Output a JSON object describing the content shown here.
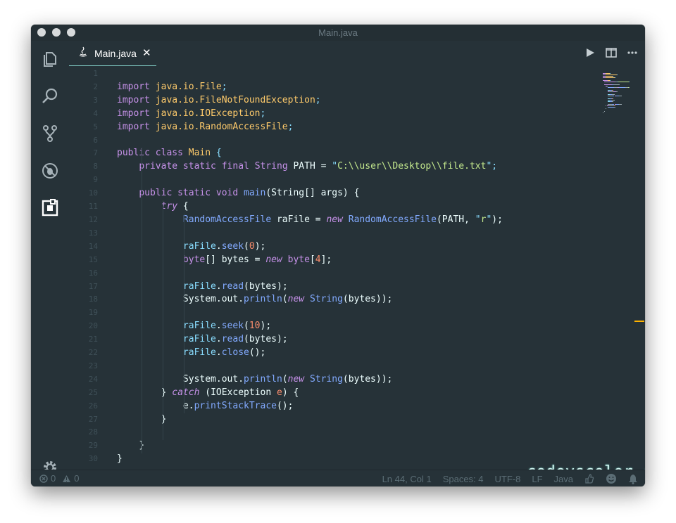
{
  "window": {
    "title": "Main.java"
  },
  "tab": {
    "label": "Main.java",
    "close": "✕"
  },
  "editor": {
    "code_lines": [
      [],
      [
        [
          "import ",
          "kw"
        ],
        [
          "java.io.File",
          "ty"
        ],
        [
          ";",
          "pu"
        ]
      ],
      [
        [
          "import ",
          "kw"
        ],
        [
          "java.io.FileNotFoundException",
          "ty"
        ],
        [
          ";",
          "pu"
        ]
      ],
      [
        [
          "import ",
          "kw"
        ],
        [
          "java.io.IOException",
          "ty"
        ],
        [
          ";",
          "pu"
        ]
      ],
      [
        [
          "import ",
          "kw"
        ],
        [
          "java.io.RandomAccessFile",
          "ty"
        ],
        [
          ";",
          "pu"
        ]
      ],
      [],
      [
        [
          "public class ",
          "kw"
        ],
        [
          "Main ",
          "ty"
        ],
        [
          "{",
          "pu"
        ]
      ],
      [
        [
          "    "
        ],
        [
          "private static final ",
          "kw"
        ],
        [
          "String ",
          "kw"
        ],
        [
          "PATH = "
        ],
        [
          "\"",
          "pu"
        ],
        [
          "C:\\\\user\\\\Desktop\\\\file.txt",
          "st"
        ],
        [
          "\";",
          "pu"
        ]
      ],
      [],
      [
        [
          "    "
        ],
        [
          "public static void ",
          "kw"
        ],
        [
          "main",
          "fn"
        ],
        [
          "(String[] args) {"
        ]
      ],
      [
        [
          "        "
        ],
        [
          "try",
          "it"
        ],
        [
          " {"
        ]
      ],
      [
        [
          "            "
        ],
        [
          "RandomAccessFile ",
          "fn"
        ],
        [
          "raFile = "
        ],
        [
          "new ",
          "it"
        ],
        [
          "RandomAccessFile",
          "fn"
        ],
        [
          "(PATH, "
        ],
        [
          "\"",
          "pu"
        ],
        [
          "r",
          "st"
        ],
        [
          "\"",
          "pu"
        ],
        [
          ");"
        ]
      ],
      [],
      [
        [
          "            "
        ],
        [
          "raFile",
          "pu"
        ],
        [
          "."
        ],
        [
          "seek",
          "fn"
        ],
        [
          "("
        ],
        [
          "0",
          "nu"
        ],
        [
          ");"
        ]
      ],
      [
        [
          "            "
        ],
        [
          "byte",
          "kw"
        ],
        [
          "[] bytes = "
        ],
        [
          "new ",
          "it"
        ],
        [
          "byte",
          "kw"
        ],
        [
          "["
        ],
        [
          "4",
          "nu"
        ],
        [
          "];"
        ]
      ],
      [],
      [
        [
          "            "
        ],
        [
          "raFile",
          "pu"
        ],
        [
          "."
        ],
        [
          "read",
          "fn"
        ],
        [
          "(bytes);"
        ]
      ],
      [
        [
          "            "
        ],
        [
          "System.out."
        ],
        [
          "println",
          "fn"
        ],
        [
          "("
        ],
        [
          "new ",
          "it"
        ],
        [
          "String",
          "fn"
        ],
        [
          "(bytes));"
        ]
      ],
      [],
      [
        [
          "            "
        ],
        [
          "raFile",
          "pu"
        ],
        [
          "."
        ],
        [
          "seek",
          "fn"
        ],
        [
          "("
        ],
        [
          "10",
          "nu"
        ],
        [
          ");"
        ]
      ],
      [
        [
          "            "
        ],
        [
          "raFile",
          "pu"
        ],
        [
          "."
        ],
        [
          "read",
          "fn"
        ],
        [
          "(bytes);"
        ]
      ],
      [
        [
          "            "
        ],
        [
          "raFile",
          "pu"
        ],
        [
          "."
        ],
        [
          "close",
          "fn"
        ],
        [
          "();"
        ]
      ],
      [],
      [
        [
          "            "
        ],
        [
          "System.out."
        ],
        [
          "println",
          "fn"
        ],
        [
          "("
        ],
        [
          "new ",
          "it"
        ],
        [
          "String",
          "fn"
        ],
        [
          "(bytes));"
        ]
      ],
      [
        [
          "        "
        ],
        [
          "} "
        ],
        [
          "catch ",
          "it"
        ],
        [
          "(IOException "
        ],
        [
          "e",
          "nu"
        ],
        [
          ") {"
        ]
      ],
      [
        [
          "            "
        ],
        [
          "e."
        ],
        [
          "printStackTrace",
          "fn"
        ],
        [
          "();"
        ]
      ],
      [
        [
          "        "
        ],
        [
          "}"
        ]
      ],
      [],
      [
        [
          "    "
        ],
        [
          "}"
        ]
      ],
      [
        [
          "}"
        ]
      ]
    ],
    "watermark": "codevscolor.com"
  },
  "statusbar": {
    "errors": "0",
    "warnings": "0",
    "position": "Ln 44, Col 1",
    "spaces": "Spaces: 4",
    "encoding": "UTF-8",
    "eol": "LF",
    "language": "Java"
  },
  "colors": {
    "background": "#263238",
    "keyword": "#c792ea",
    "type": "#ffcb6b",
    "function": "#82aaff",
    "string": "#c3e88d",
    "number": "#f78c6c",
    "punctuation": "#89ddff",
    "tab_underline": "#80cbc4",
    "scroll_marker": "#ffb300"
  },
  "icons": {
    "activity": [
      "files-icon",
      "search-icon",
      "source-control-icon",
      "debug-icon",
      "extensions-icon",
      "settings-gear-icon"
    ],
    "tab_actions": [
      "run-icon",
      "split-editor-icon",
      "more-actions-icon"
    ],
    "status": [
      "error-icon",
      "warning-icon",
      "feedback-icon",
      "smiley-icon",
      "bell-icon"
    ]
  }
}
